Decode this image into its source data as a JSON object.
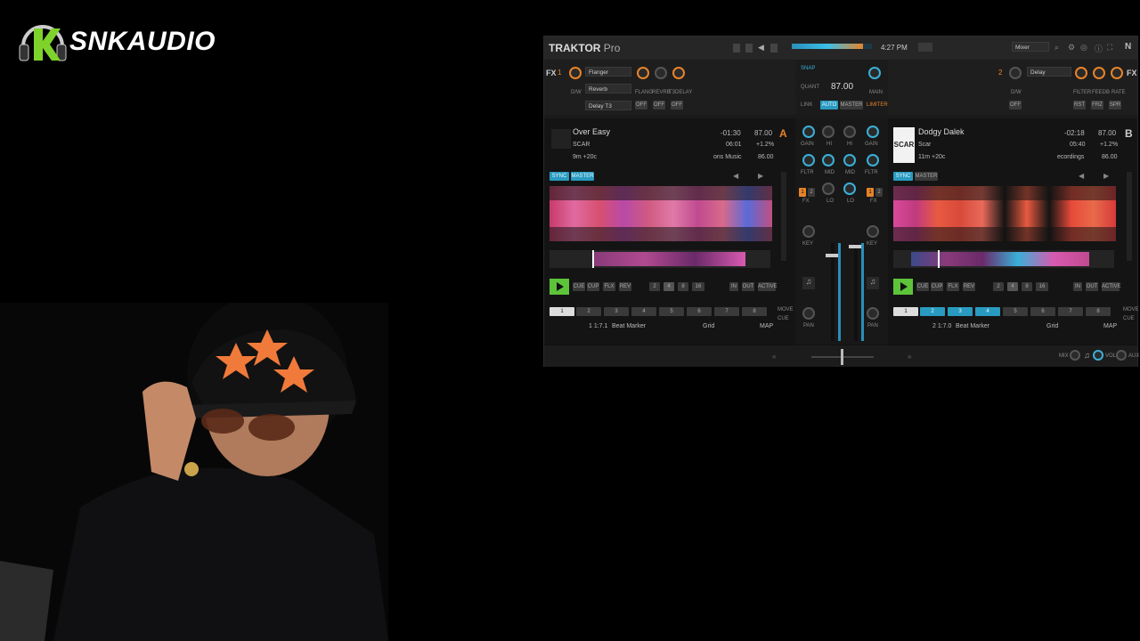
{
  "overlay": {
    "logo_text": "SNKAUDIO"
  },
  "app": {
    "brand_main": "TRAKTOR",
    "brand_sub": "Pro",
    "clock": "4:27 PM",
    "layout_select": "Mixer"
  },
  "fx_left": {
    "unit_label": "FX",
    "unit_num": "1",
    "slot1": "Flanger",
    "slot2": "Reverb",
    "slot3": "Delay T3",
    "dw_label": "D/W",
    "k1": "FLANG",
    "k2": "REVRB",
    "k3": "T3DELAY",
    "b1": "OFF",
    "b2": "OFF",
    "b3": "OFF"
  },
  "fx_right": {
    "unit_label": "FX",
    "unit_num": "2",
    "slot1": "Delay",
    "dw_label": "D/W",
    "off": "OFF",
    "k1": "FILTER",
    "k2": "FEEDB",
    "k3": "RATE",
    "b1": "RST",
    "b2": "FRZ",
    "b3": "SPR"
  },
  "master": {
    "snap": "SNAP",
    "quant": "QUANT",
    "bpm": "87.00",
    "main": "MAIN",
    "link": "LINK",
    "auto": "AUTO",
    "master": "MASTER",
    "limiter": "LIMITER"
  },
  "deck_a": {
    "letter": "A",
    "title": "Over Easy",
    "artist": "SCAR",
    "key": "9m +20c",
    "remaining": "-01:30",
    "elapsed": "06:01",
    "label": "ons Music",
    "bpm": "87.00",
    "pitch": "+1.2%",
    "base_bpm": "86.00",
    "sync": "SYNC",
    "master": "MASTER",
    "cue": "CUE",
    "cup": "CUP",
    "flx": "FLX",
    "rev": "REV",
    "loops": [
      "2",
      "4",
      "8",
      "16"
    ],
    "in": "IN",
    "out": "OUT",
    "active": "ACTIVE",
    "hotcues": [
      "1",
      "2",
      "3",
      "4",
      "5",
      "6",
      "7",
      "8"
    ],
    "cue_info": "1 1:7.1",
    "cue_name": "Beat Marker",
    "grid": "Grid",
    "map": "MAP",
    "move": "MOVE",
    "cue_small": "CUE"
  },
  "deck_b": {
    "letter": "B",
    "title": "Dodgy Dalek",
    "artist": "Scar",
    "key": "11m +20c",
    "remaining": "-02:18",
    "elapsed": "05:40",
    "label": "ecordings",
    "bpm": "87.00",
    "pitch": "+1.2%",
    "base_bpm": "86.00",
    "art_text": "SCAR",
    "sync": "SYNC",
    "master": "MASTER",
    "cue": "CUE",
    "cup": "CUP",
    "flx": "FLX",
    "rev": "REV",
    "loops": [
      "2",
      "4",
      "8",
      "16"
    ],
    "in": "IN",
    "out": "OUT",
    "active": "ACTIVE",
    "hotcues": [
      "1",
      "2",
      "3",
      "4",
      "5",
      "6",
      "7",
      "8"
    ],
    "cue_info": "2 1:7.0",
    "cue_name": "Beat Marker",
    "grid": "Grid",
    "map": "MAP",
    "move": "MOVE",
    "cue_small": "CUE"
  },
  "mixer": {
    "gain": "GAIN",
    "hi": "HI",
    "mid": "MID",
    "lo": "LO",
    "fltr": "FLTR",
    "fx": "FX",
    "key": "KEY",
    "pan": "PAN",
    "fx1": "1",
    "fx2": "2"
  },
  "footer": {
    "mix": "MIX",
    "vol": "VOL",
    "aux": "AUX"
  },
  "colors": {
    "accent_orange": "#e8832a",
    "accent_cyan": "#3ab0d8",
    "play_green": "#5dc43a"
  }
}
